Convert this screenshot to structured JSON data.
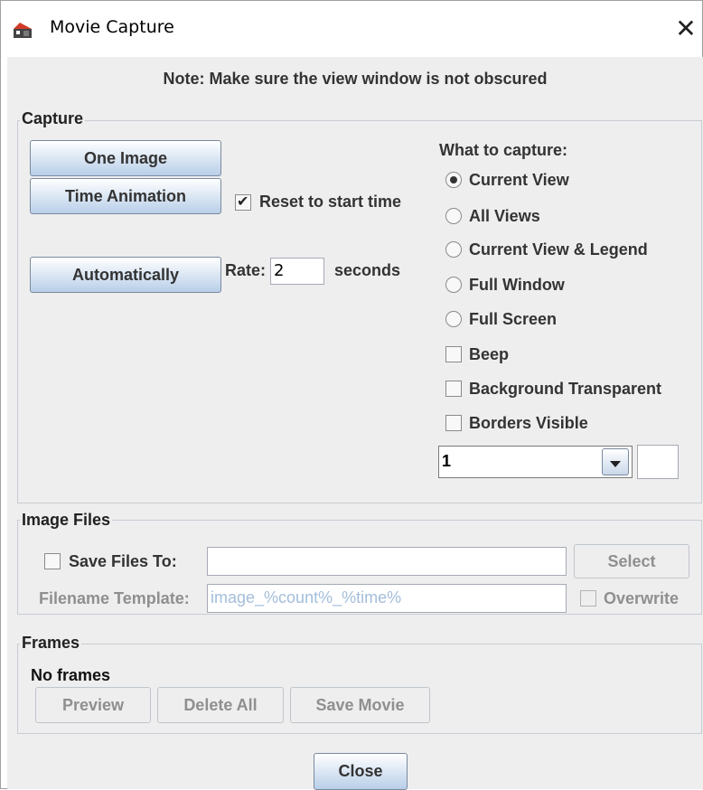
{
  "window": {
    "title": "Movie Capture",
    "close_icon": "close-icon",
    "app_icon": "movie-camera-icon"
  },
  "note": "Note: Make sure the view window is not obscured",
  "capture": {
    "legend": "Capture",
    "one_image": "One Image",
    "time_animation": "Time Animation",
    "reset_to_start": "Reset to start time",
    "reset_checked": true,
    "automatically": "Automatically",
    "rate_label": "Rate:",
    "rate_value": "2",
    "seconds_label": "seconds",
    "what_to_capture": "What to capture:",
    "options": [
      {
        "label": "Current View",
        "selected": true
      },
      {
        "label": "All Views",
        "selected": false
      },
      {
        "label": "Current View & Legend",
        "selected": false
      },
      {
        "label": "Full Window",
        "selected": false
      },
      {
        "label": "Full Screen",
        "selected": false
      }
    ],
    "beep": "Beep",
    "background_transparent": "Background Transparent",
    "borders_visible": "Borders Visible",
    "combo_value": "1",
    "combo_extra_value": ""
  },
  "image_files": {
    "legend": "Image Files",
    "save_files_to": "Save Files To:",
    "save_path_value": "",
    "select": "Select",
    "filename_template_label": "Filename Template:",
    "filename_template_value": "image_%count%_%time%",
    "overwrite": "Overwrite"
  },
  "frames": {
    "legend": "Frames",
    "status": "No frames",
    "preview": "Preview",
    "delete_all": "Delete All",
    "save_movie": "Save Movie"
  },
  "close_button": "Close",
  "colors": {
    "panel_bg": "#eeeeee",
    "button_gradient_bottom": "#b8cfe8",
    "disabled_text": "#8f8f8f",
    "disabled_field_text": "#a3bedb"
  }
}
